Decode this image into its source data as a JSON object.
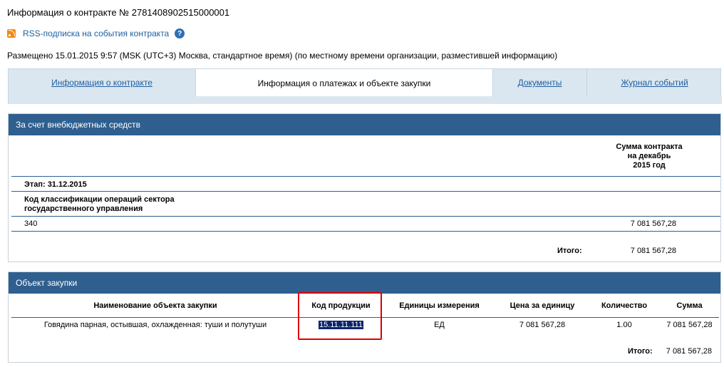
{
  "header": {
    "title": "Информация о контракте № 2781408902515000001",
    "rss_link": "RSS-подписка на события контракта",
    "help_glyph": "?",
    "posted": "Размещено 15.01.2015 9:57 (MSK (UTC+3) Москва, стандартное время) (по местному времени организации, разместившей информацию)"
  },
  "tabs": [
    {
      "label": "Информация о контракте",
      "active": false
    },
    {
      "label": "Информация о платежах и объекте закупки",
      "active": true
    },
    {
      "label": "Документы",
      "active": false
    },
    {
      "label": "Журнал событий",
      "active": false
    }
  ],
  "funding": {
    "header": "За счет внебюджетных средств",
    "sum_col_line1": "Сумма контракта",
    "sum_col_line2": "на декабрь",
    "sum_col_line3": "2015 год",
    "stage": "Этап: 31.12.2015",
    "kosgu_line1": "Код классификации операций сектора",
    "kosgu_line2": "государственного управления",
    "code": "340",
    "amount": "7 081 567,28",
    "total_label": "Итого:",
    "total_value": "7 081 567,28"
  },
  "procurement": {
    "header": "Объект закупки",
    "columns": [
      "Наименование объекта закупки",
      "Код продукции",
      "Единицы измерения",
      "Цена за единицу",
      "Количество",
      "Сумма"
    ],
    "rows": [
      [
        "Говядина парная, остывшая, охлажденная: туши и полутуши",
        "15.11.11.111",
        "ЕД",
        "7 081 567,28",
        "1.00",
        "7 081 567,28"
      ]
    ],
    "total_label": "Итого:",
    "total_value": "7 081 567,28"
  },
  "colors": {
    "panel_header": "#2f5f8f",
    "link": "#1f5fa0",
    "tabs_bg": "#dbe7f0",
    "highlight_box": "#e00000",
    "selection": "#0a246a"
  }
}
